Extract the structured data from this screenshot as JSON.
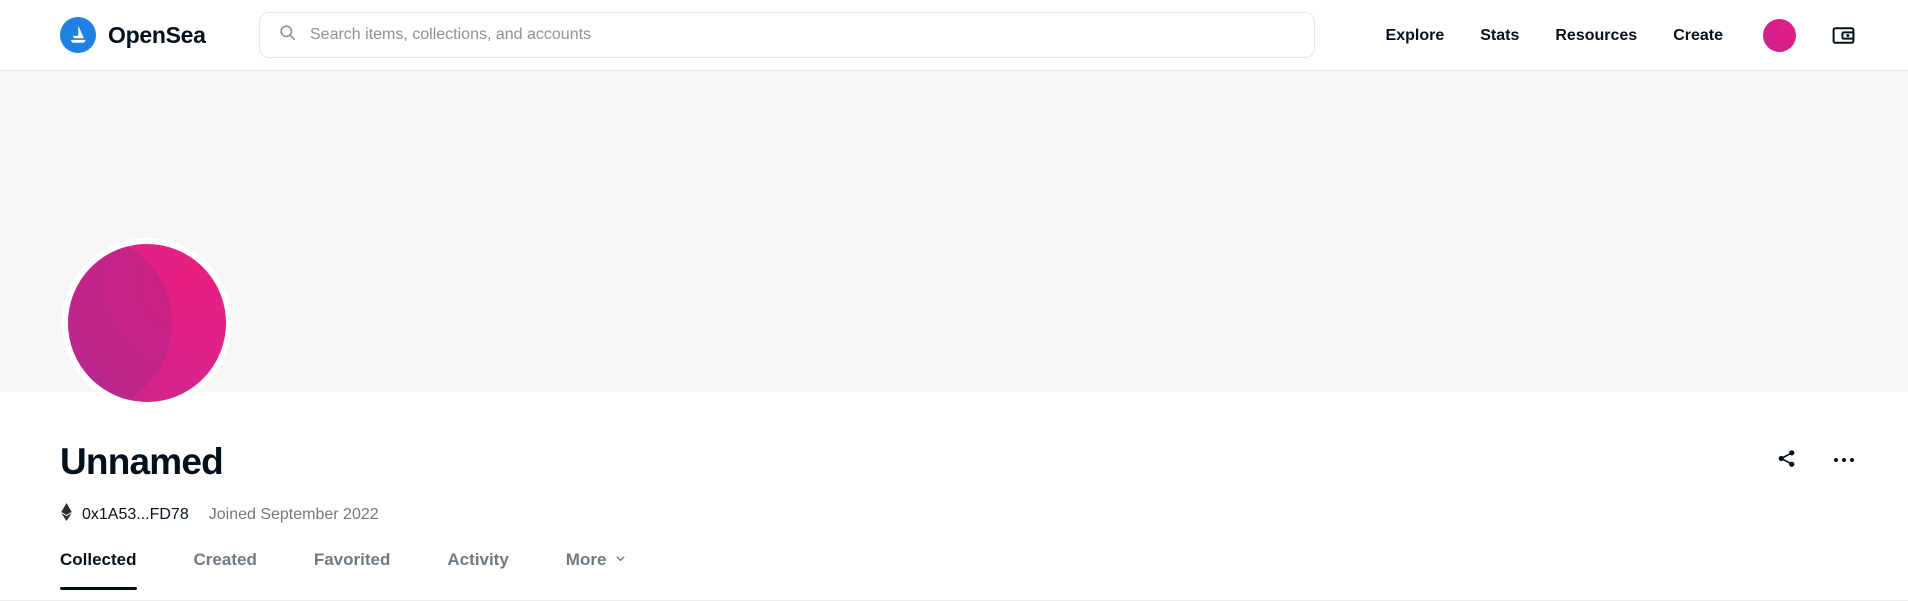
{
  "header": {
    "brand_name": "OpenSea",
    "brand_icon": "sailboat-logo-icon",
    "search": {
      "placeholder": "Search items, collections, and accounts",
      "value": "",
      "icon": "search-icon"
    },
    "nav_links": [
      {
        "label": "Explore"
      },
      {
        "label": "Stats"
      },
      {
        "label": "Resources"
      },
      {
        "label": "Create"
      }
    ],
    "account_avatar_icon": "account-avatar",
    "wallet_icon": "wallet-icon"
  },
  "profile": {
    "banner_color": "#f5f6f8",
    "avatar_icon": "profile-avatar",
    "display_name": "Unnamed",
    "chain_icon": "ethereum-icon",
    "address": "0x1A53...FD78",
    "joined": "Joined September 2022",
    "share_icon": "share-icon",
    "more_options_icon": "more-options-icon"
  },
  "tabs": {
    "items": [
      {
        "label": "Collected",
        "active": true
      },
      {
        "label": "Created",
        "active": false
      },
      {
        "label": "Favorited",
        "active": false
      },
      {
        "label": "Activity",
        "active": false
      },
      {
        "label": "More",
        "active": false,
        "icon": "chevron-down-icon"
      }
    ]
  },
  "colors": {
    "brand_blue": "#2081e2",
    "text_primary": "#04111d",
    "text_muted": "#707a83",
    "border": "#e5e8eb",
    "accent_pink": "#e0218a"
  }
}
